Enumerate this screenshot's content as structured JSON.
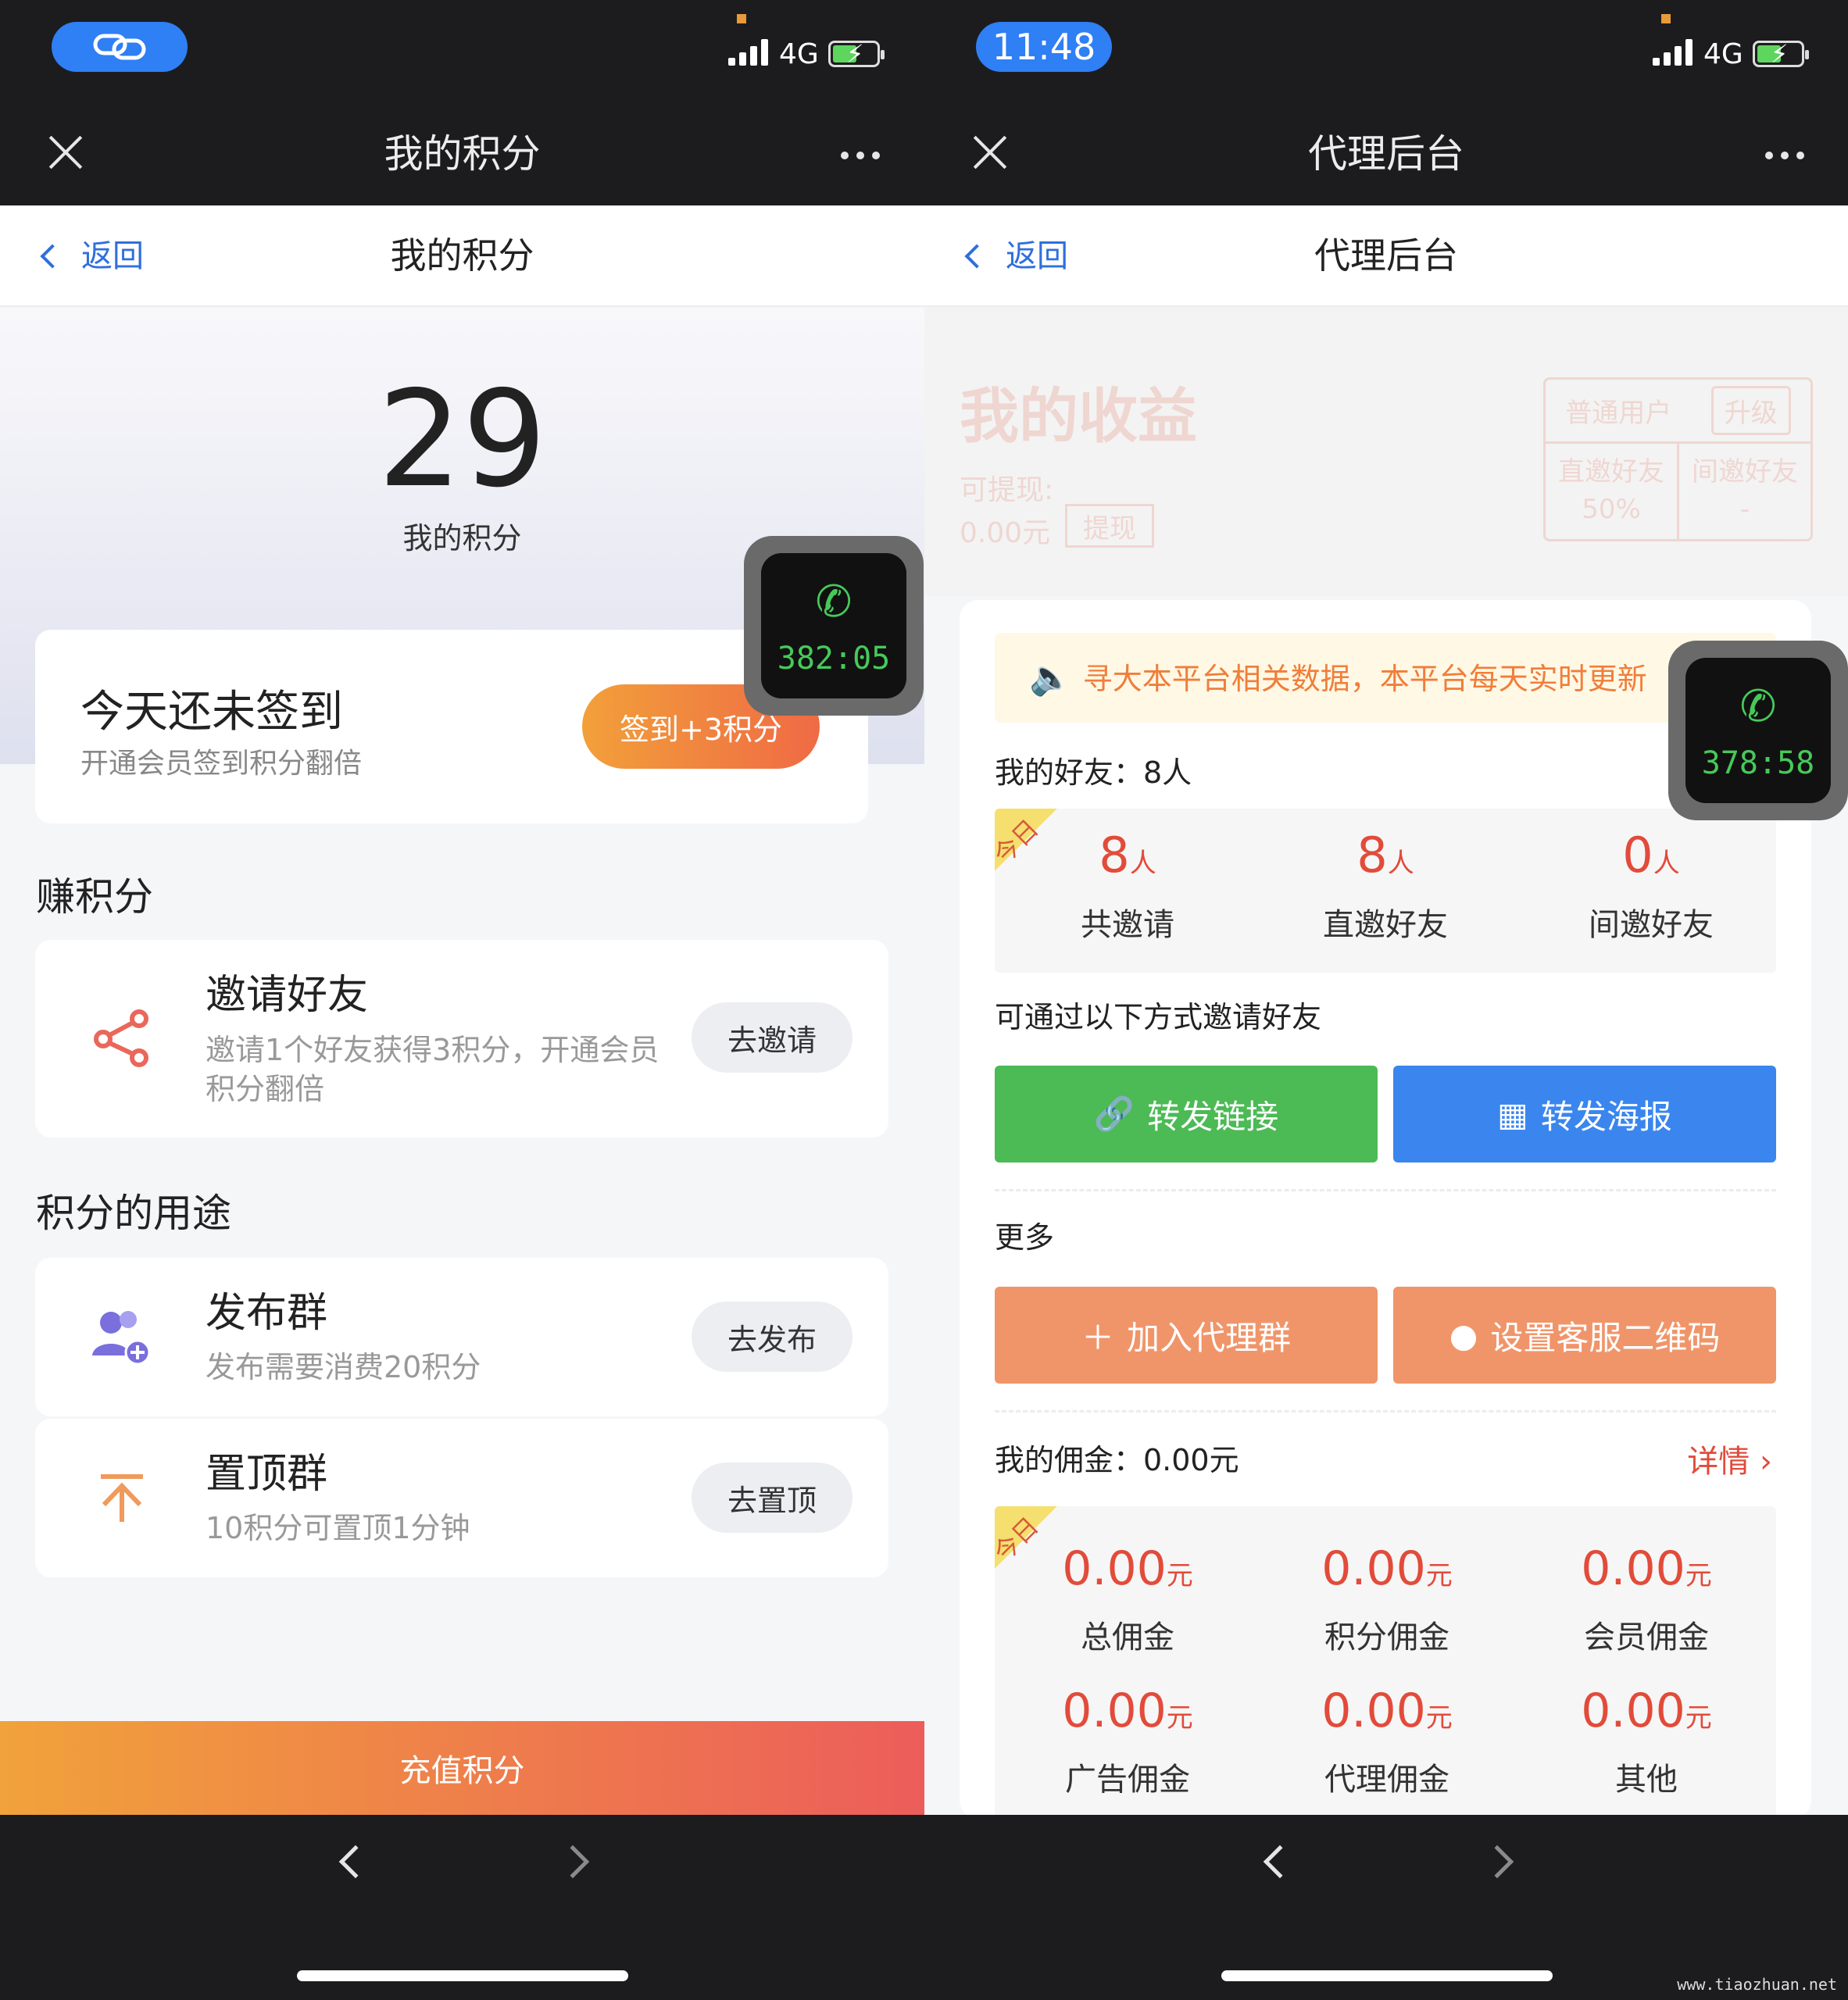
{
  "left": {
    "status_time": "",
    "network": "4G",
    "nav_title": "我的积分",
    "back_label": "返回",
    "sub_title": "我的积分",
    "points_value": "29",
    "points_label": "我的积分",
    "call_timer": "382:05",
    "signin": {
      "title": "今天还未签到",
      "subtitle": "开通会员签到积分翻倍",
      "button": "签到+3积分"
    },
    "earn_section": "赚积分",
    "invite": {
      "title": "邀请好友",
      "desc": "邀请1个好友获得3积分，开通会员积分翻倍",
      "button": "去邀请"
    },
    "usage_section": "积分的用途",
    "publish": {
      "title": "发布群",
      "desc": "发布需要消费20积分",
      "button": "去发布"
    },
    "pin": {
      "title": "置顶群",
      "desc": "10积分可置顶1分钟",
      "button": "去置顶"
    },
    "recharge_button": "充值积分"
  },
  "right": {
    "status_time": "11:48",
    "network": "4G",
    "nav_title": "代理后台",
    "back_label": "返回",
    "sub_title": "代理后台",
    "call_timer": "378:58",
    "earnings": {
      "title": "我的收益",
      "withdrawable_label": "可提现:",
      "withdrawable_value": "0.00元",
      "withdraw_button": "提现",
      "user_type": "普通用户",
      "upgrade_button": "升级",
      "direct_label": "直邀好友",
      "direct_value": "50%",
      "indirect_label": "间邀好友",
      "indirect_value": "-"
    },
    "notice": "寻大本平台相关数据，本平台每天实时更新",
    "friends_label": "我的好友：8人",
    "ribbon": "今日",
    "friend_stats": [
      {
        "value": "8",
        "unit": "人",
        "label": "共邀请"
      },
      {
        "value": "8",
        "unit": "人",
        "label": "直邀好友"
      },
      {
        "value": "0",
        "unit": "人",
        "label": "间邀好友"
      }
    ],
    "invite_methods_label": "可通过以下方式邀请好友",
    "share_link_button": "转发链接",
    "share_poster_button": "转发海报",
    "more_label": "更多",
    "join_group_button": "加入代理群",
    "set_qr_button": "设置客服二维码",
    "commission_label": "我的佣金：0.00元",
    "detail_link": "详情",
    "commission_stats": [
      {
        "value": "0.00",
        "unit": "元",
        "label": "总佣金"
      },
      {
        "value": "0.00",
        "unit": "元",
        "label": "积分佣金"
      },
      {
        "value": "0.00",
        "unit": "元",
        "label": "会员佣金"
      },
      {
        "value": "0.00",
        "unit": "元",
        "label": "广告佣金"
      },
      {
        "value": "0.00",
        "unit": "元",
        "label": "代理佣金"
      },
      {
        "value": "0.00",
        "unit": "元",
        "label": "其他"
      }
    ]
  },
  "watermark": "www.tiaozhuan.net",
  "colors": {
    "accent_blue": "#2f7ff5",
    "link_blue": "#2f6fdc",
    "orange": "#f2a03a",
    "red": "#e24b3a",
    "green_button": "#4cba55",
    "blue_button": "#3a86ee",
    "salmon_button": "#f0956a"
  }
}
